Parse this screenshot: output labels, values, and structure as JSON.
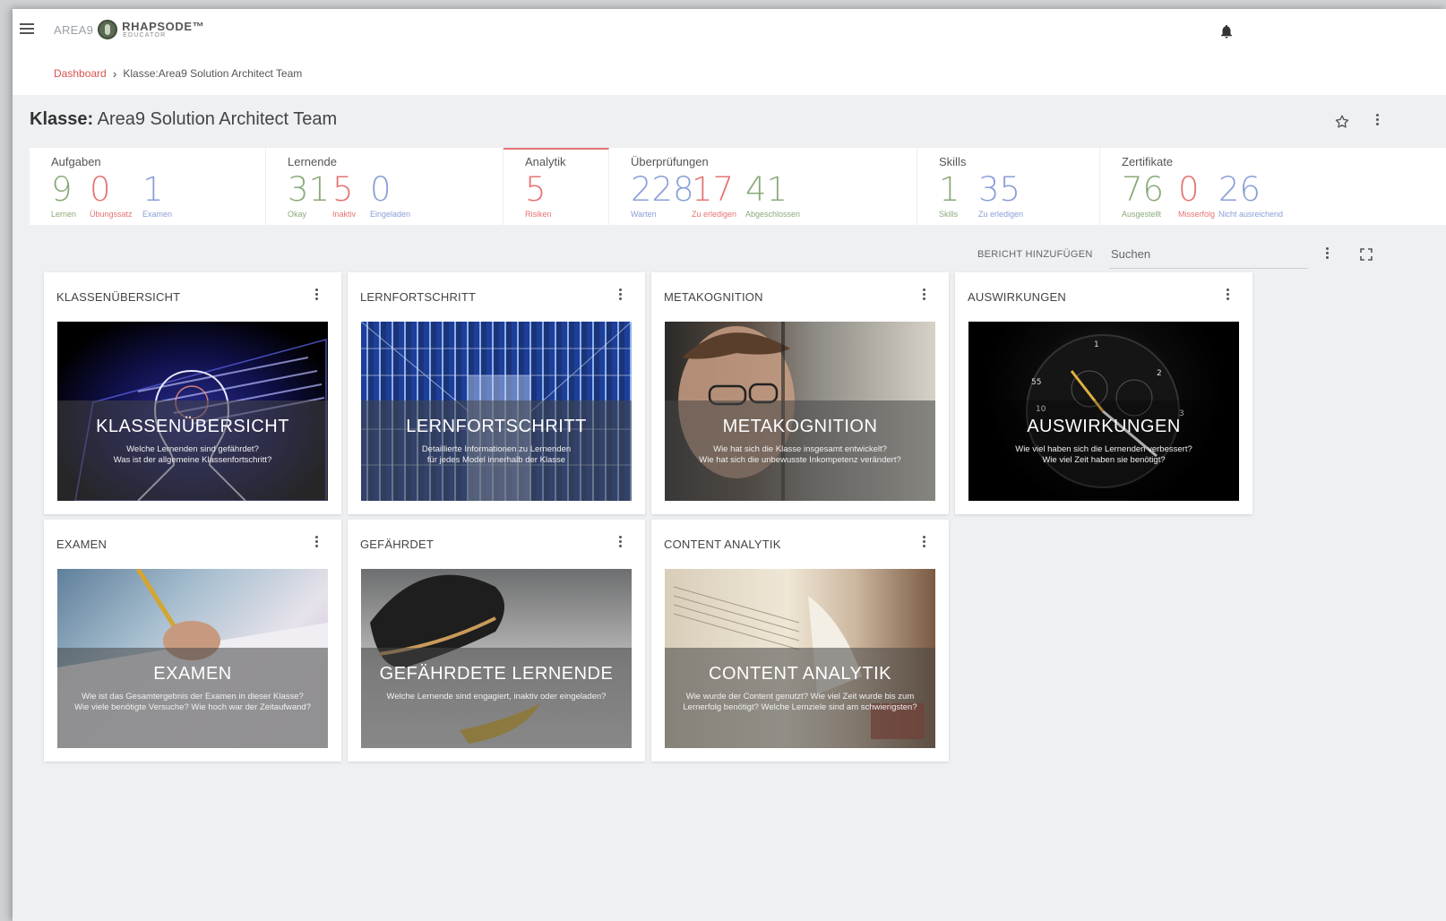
{
  "header": {
    "brand_prefix": "AREA9",
    "brand_name": "RHAPSODE™",
    "brand_sub": "EDUCATOR"
  },
  "breadcrumb": {
    "root": "Dashboard",
    "current": "Klasse:Area9 Solution Architect Team"
  },
  "page": {
    "title_prefix": "Klasse:",
    "title": "Area9 Solution Architect Team"
  },
  "stats": [
    {
      "title": "Aufgaben",
      "values": [
        {
          "num": "9",
          "label": "Lernen",
          "color": "#8aaa7a"
        },
        {
          "num": "0",
          "label": "Übungssatz",
          "color": "#e57373"
        },
        {
          "num": "1",
          "label": "Examen",
          "color": "#8a9ed8"
        }
      ]
    },
    {
      "title": "Lernende",
      "values": [
        {
          "num": "31",
          "label": "Okay",
          "color": "#8aaa7a"
        },
        {
          "num": "5",
          "label": "Inaktiv",
          "color": "#e57373"
        },
        {
          "num": "0",
          "label": "Eingeladen",
          "color": "#8a9ed8"
        }
      ]
    },
    {
      "title": "Analytik",
      "values": [
        {
          "num": "5",
          "label": "Risiken",
          "color": "#e57373"
        }
      ]
    },
    {
      "title": "Überprüfungen",
      "values": [
        {
          "num": "228",
          "label": "Warten",
          "color": "#8a9ed8"
        },
        {
          "num": "17",
          "label": "Zu erledigen",
          "color": "#e57373"
        },
        {
          "num": "41",
          "label": "Abgeschlossen",
          "color": "#8aaa7a"
        }
      ]
    },
    {
      "title": "Skills",
      "values": [
        {
          "num": "1",
          "label": "Skills",
          "color": "#8aaa7a"
        },
        {
          "num": "35",
          "label": "Zu erledigen",
          "color": "#8a9ed8"
        }
      ]
    },
    {
      "title": "Zertifikate",
      "values": [
        {
          "num": "76",
          "label": "Ausgestellt",
          "color": "#8aaa7a"
        },
        {
          "num": "0",
          "label": "Misserfolg",
          "color": "#e57373"
        },
        {
          "num": "26",
          "label": "Nicht ausreichend",
          "color": "#8a9ed8"
        }
      ]
    }
  ],
  "toolbar": {
    "report_label": "BERICHT HINZUFÜGEN",
    "search_placeholder": "Suchen"
  },
  "cards": [
    {
      "header": "KLASSENÜBERSICHT",
      "title": "KLASSENÜBERSICHT",
      "desc": [
        "Welche Lernenden sind gefährdet?",
        "Was ist der allgemeine Klassenfortschritt?"
      ]
    },
    {
      "header": "LERNFORTSCHRITT",
      "title": "LERNFORTSCHRITT",
      "desc": [
        "Detaillierte Informationen zu Lernenden",
        "für jedes Model innerhalb der Klasse"
      ]
    },
    {
      "header": "METAKOGNITION",
      "title": "METAKOGNITION",
      "desc": [
        "Wie hat sich die Klasse insgesamt entwickelt?",
        "Wie hat sich die unbewusste Inkompetenz verändert?"
      ]
    },
    {
      "header": "AUSWIRKUNGEN",
      "title": "AUSWIRKUNGEN",
      "desc": [
        "Wie viel haben sich die Lernenden verbessert?",
        "Wie viel Zeit haben sie benötigt?"
      ]
    },
    {
      "header": "EXAMEN",
      "title": "EXAMEN",
      "desc": [
        "Wie ist das Gesamtergebnis der Examen in dieser Klasse?",
        "Wie viele benötigte Versuche? Wie hoch war der Zeitaufwand?"
      ]
    },
    {
      "header": "GEFÄHRDET",
      "title": "GEFÄHRDETE LERNENDE",
      "desc": [
        "Welche Lernende sind engagiert, inaktiv oder eingeladen?",
        ""
      ]
    },
    {
      "header": "CONTENT ANALYTIK",
      "title": "CONTENT ANALYTIK",
      "desc": [
        "Wie wurde der Content genutzt? Wie viel Zeit wurde bis zum",
        "Lernerfolg benötigt? Welche Lernziele sind am schwierigsten?"
      ]
    }
  ],
  "colors": {
    "accent_red": "#e57373",
    "accent_green": "#8aaa7a",
    "accent_blue": "#8a9ed8"
  }
}
